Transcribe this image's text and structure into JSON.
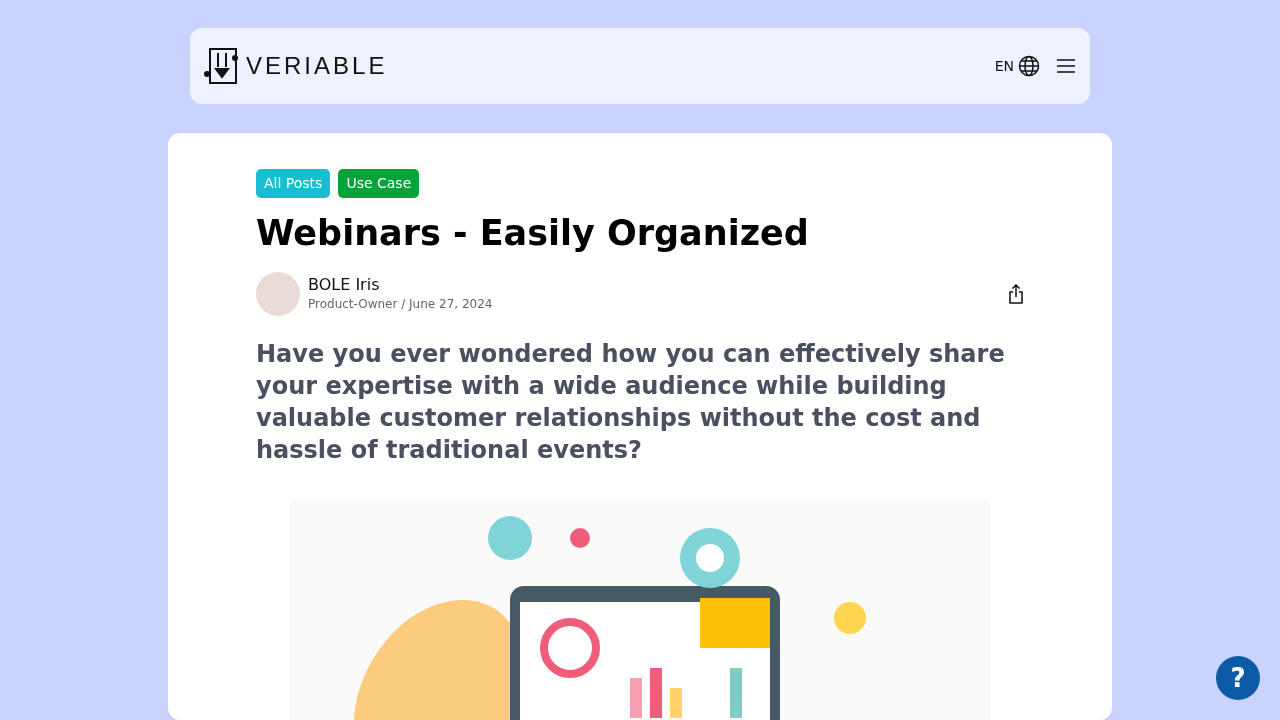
{
  "header": {
    "logo_text": "VERIABLE",
    "language": "EN"
  },
  "tags": [
    {
      "label": "All Posts",
      "color": "#17becf"
    },
    {
      "label": "Use Case",
      "color": "#05a33a"
    }
  ],
  "article": {
    "title": "Webinars - Easily Organized",
    "author": {
      "name": "BOLE Iris",
      "meta": "Product-Owner / June 27, 2024"
    },
    "lead": "Have you ever wondered how you can effectively share your expertise with a wide audience while building valuable customer relationships without the cost and hassle of traditional events?"
  },
  "help_button": {
    "label": "?"
  }
}
